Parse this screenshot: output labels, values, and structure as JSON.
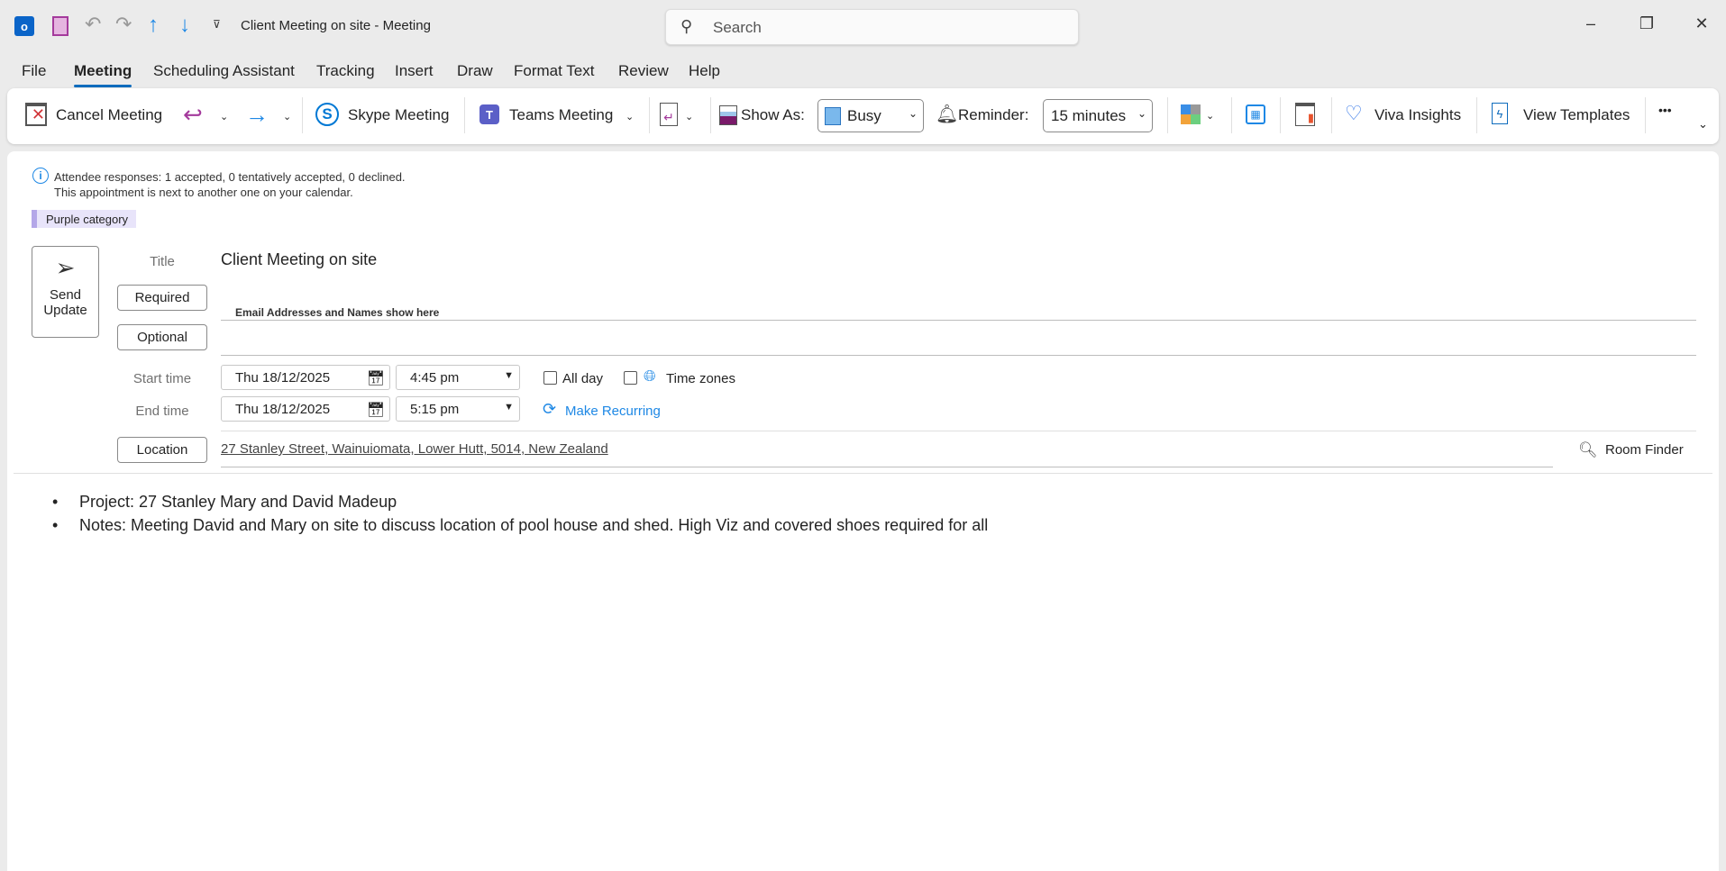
{
  "titlebar": {
    "title": "Client Meeting on site  -  Meeting",
    "search_placeholder": "Search"
  },
  "tabs": [
    "File",
    "Meeting",
    "Scheduling Assistant",
    "Tracking",
    "Insert",
    "Draw",
    "Format Text",
    "Review",
    "Help"
  ],
  "active_tab": "Meeting",
  "ribbon": {
    "cancel_meeting": "Cancel Meeting",
    "skype_meeting": "Skype Meeting",
    "teams_meeting": "Teams Meeting",
    "show_as_label": "Show As:",
    "show_as_value": "Busy",
    "reminder_label": "Reminder:",
    "reminder_value": "15 minutes",
    "viva_insights": "Viva Insights",
    "view_templates": "View Templates",
    "more": "•••"
  },
  "info": {
    "line1": "Attendee responses: 1 accepted, 0 tentatively accepted, 0 declined.",
    "line2": "This appointment is next to another one on your calendar."
  },
  "category": {
    "label": "Purple category",
    "color": "#b4a7e8"
  },
  "form": {
    "send_update": [
      "Send",
      "Update"
    ],
    "title_label": "Title",
    "title_value": "Client Meeting on site",
    "required_label": "Required",
    "required_value": "Email Addresses and Names show here",
    "optional_label": "Optional",
    "start_label": "Start time",
    "start_date": "Thu 18/12/2025",
    "start_time": "4:45 pm",
    "end_label": "End time",
    "end_date": "Thu 18/12/2025",
    "end_time": "5:15 pm",
    "all_day": "All day",
    "time_zones": "Time zones",
    "make_recurring": "Make Recurring",
    "location_label": "Location",
    "location_value": "27 Stanley Street, Wainuiomata, Lower Hutt, 5014, New Zealand",
    "room_finder": "Room Finder"
  },
  "body": [
    "Project: 27 Stanley Mary and David Madeup",
    "Notes: Meeting David and Mary on site to discuss location of pool house and shed. High Viz and covered shoes required for all"
  ]
}
